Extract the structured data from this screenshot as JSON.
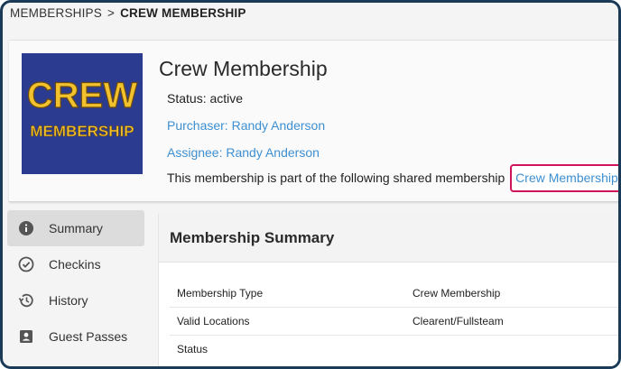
{
  "breadcrumb": {
    "root": "MEMBERSHIPS",
    "separator": ">",
    "current": "CREW MEMBERSHIP"
  },
  "logo": {
    "line1": "CREW",
    "line2": "MEMBERSHIP",
    "bg_color": "#2b3b8f",
    "text_color": "#f2c12e"
  },
  "header": {
    "title": "Crew Membership",
    "status": "Status: active",
    "purchaser": "Purchaser: Randy Anderson",
    "assignee": "Assignee: Randy Anderson",
    "shared_text": "This membership is part of the following shared membership",
    "shared_link": "Crew Membership"
  },
  "sidebar": {
    "items": [
      {
        "label": "Summary",
        "icon": "info-icon",
        "active": true
      },
      {
        "label": "Checkins",
        "icon": "check-circle-icon",
        "active": false
      },
      {
        "label": "History",
        "icon": "history-icon",
        "active": false
      },
      {
        "label": "Guest Passes",
        "icon": "guest-pass-icon",
        "active": false
      }
    ]
  },
  "summary": {
    "title": "Membership Summary",
    "rows": [
      {
        "key": "Membership Type",
        "value": "Crew Membership"
      },
      {
        "key": "Valid Locations",
        "value": "Clearent/Fullsteam"
      },
      {
        "key": "Status",
        "value": ""
      }
    ]
  },
  "colors": {
    "link": "#3d8fd1",
    "highlight_border": "#d1145a",
    "frame_border": "#1b3a57"
  }
}
